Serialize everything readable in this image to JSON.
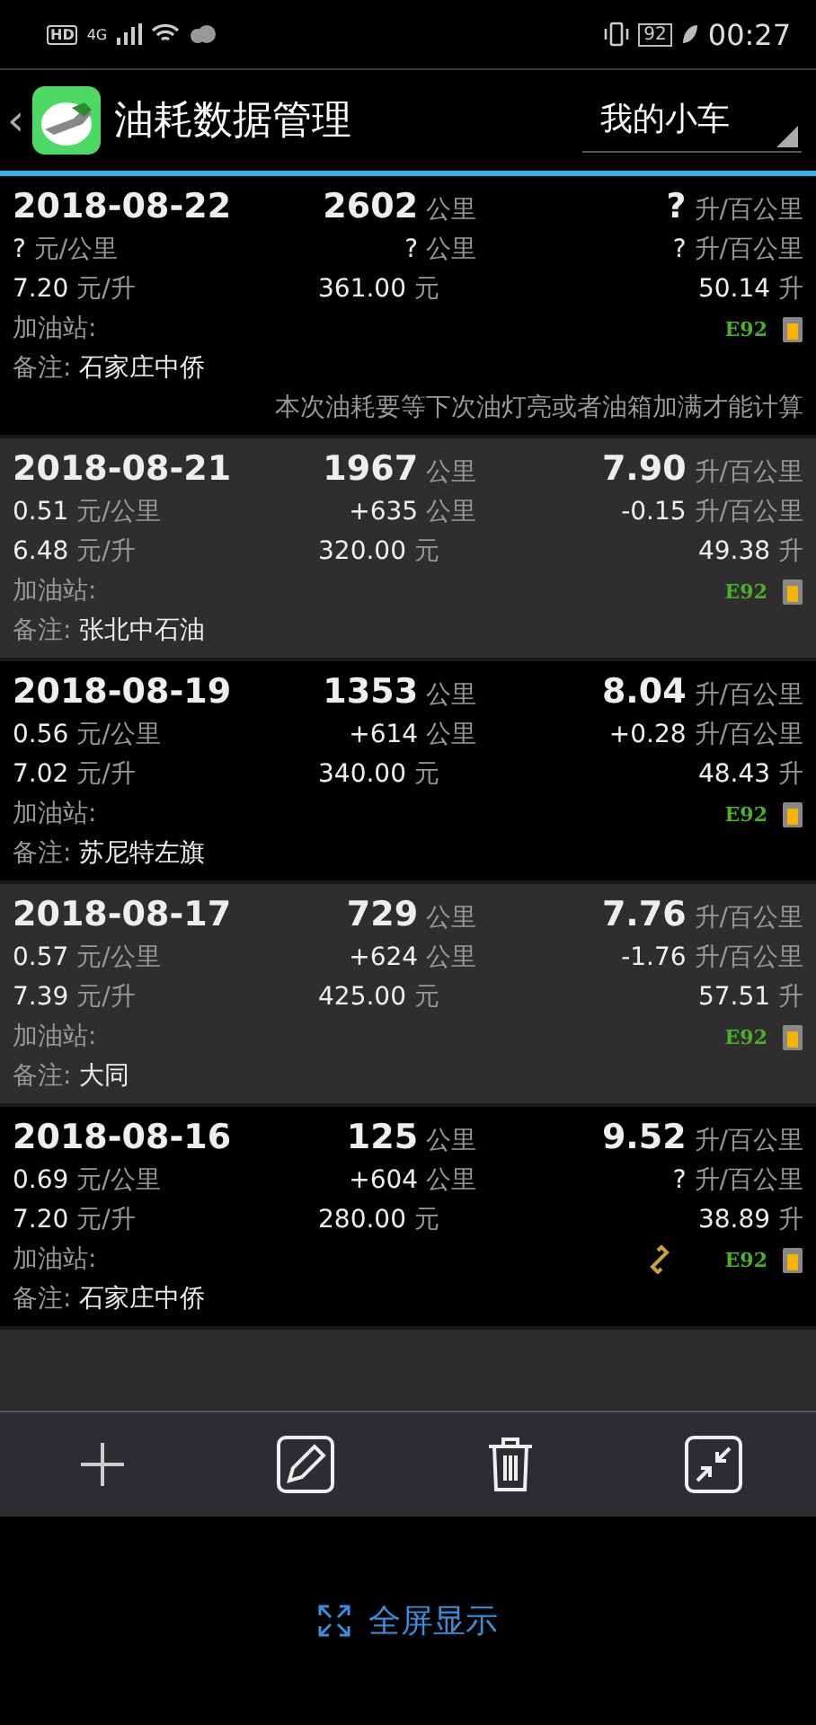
{
  "status_bar": {
    "hd": "HD",
    "network": "4G",
    "battery": "92",
    "time": "00:27"
  },
  "header": {
    "back": "‹",
    "title": "油耗数据管理",
    "car_selector": "我的小车"
  },
  "entries": [
    {
      "date": "2018-08-22",
      "odometer": "2602",
      "odometer_unit": "公里",
      "consumption": "?",
      "consumption_unit": "升/百公里",
      "cost_per_km": "?",
      "cost_per_km_unit": "元/公里",
      "distance": "?",
      "distance_unit": "公里",
      "consumption_change": "?",
      "consumption_change_unit": "升/百公里",
      "price": "7.20",
      "price_unit": "元/升",
      "amount": "361.00",
      "amount_unit": "元",
      "volume": "50.14",
      "volume_unit": "升",
      "station_label": "加油站:",
      "linked": false,
      "grade": "E92",
      "note_label": "备注:",
      "note": "石家庄中侨",
      "message": "本次油耗要等下次油灯亮或者油箱加满才能计算"
    },
    {
      "date": "2018-08-21",
      "odometer": "1967",
      "odometer_unit": "公里",
      "consumption": "7.90",
      "consumption_unit": "升/百公里",
      "cost_per_km": "0.51",
      "cost_per_km_unit": "元/公里",
      "distance": "+635",
      "distance_unit": "公里",
      "consumption_change": "-0.15",
      "consumption_change_unit": "升/百公里",
      "price": "6.48",
      "price_unit": "元/升",
      "amount": "320.00",
      "amount_unit": "元",
      "volume": "49.38",
      "volume_unit": "升",
      "station_label": "加油站:",
      "linked": false,
      "grade": "E92",
      "note_label": "备注:",
      "note": "张北中石油"
    },
    {
      "date": "2018-08-19",
      "odometer": "1353",
      "odometer_unit": "公里",
      "consumption": "8.04",
      "consumption_unit": "升/百公里",
      "cost_per_km": "0.56",
      "cost_per_km_unit": "元/公里",
      "distance": "+614",
      "distance_unit": "公里",
      "consumption_change": "+0.28",
      "consumption_change_unit": "升/百公里",
      "price": "7.02",
      "price_unit": "元/升",
      "amount": "340.00",
      "amount_unit": "元",
      "volume": "48.43",
      "volume_unit": "升",
      "station_label": "加油站:",
      "linked": false,
      "grade": "E92",
      "note_label": "备注:",
      "note": "苏尼特左旗"
    },
    {
      "date": "2018-08-17",
      "odometer": "729",
      "odometer_unit": "公里",
      "consumption": "7.76",
      "consumption_unit": "升/百公里",
      "cost_per_km": "0.57",
      "cost_per_km_unit": "元/公里",
      "distance": "+624",
      "distance_unit": "公里",
      "consumption_change": "-1.76",
      "consumption_change_unit": "升/百公里",
      "price": "7.39",
      "price_unit": "元/升",
      "amount": "425.00",
      "amount_unit": "元",
      "volume": "57.51",
      "volume_unit": "升",
      "station_label": "加油站:",
      "linked": false,
      "grade": "E92",
      "note_label": "备注:",
      "note": "大同"
    },
    {
      "date": "2018-08-16",
      "odometer": "125",
      "odometer_unit": "公里",
      "consumption": "9.52",
      "consumption_unit": "升/百公里",
      "cost_per_km": "0.69",
      "cost_per_km_unit": "元/公里",
      "distance": "+604",
      "distance_unit": "公里",
      "consumption_change": "?",
      "consumption_change_unit": "升/百公里",
      "price": "7.20",
      "price_unit": "元/升",
      "amount": "280.00",
      "amount_unit": "元",
      "volume": "38.89",
      "volume_unit": "升",
      "station_label": "加油站:",
      "linked": true,
      "grade": "E92",
      "note_label": "备注:",
      "note": "石家庄中侨"
    }
  ],
  "fullscreen_link": "全屏显示"
}
